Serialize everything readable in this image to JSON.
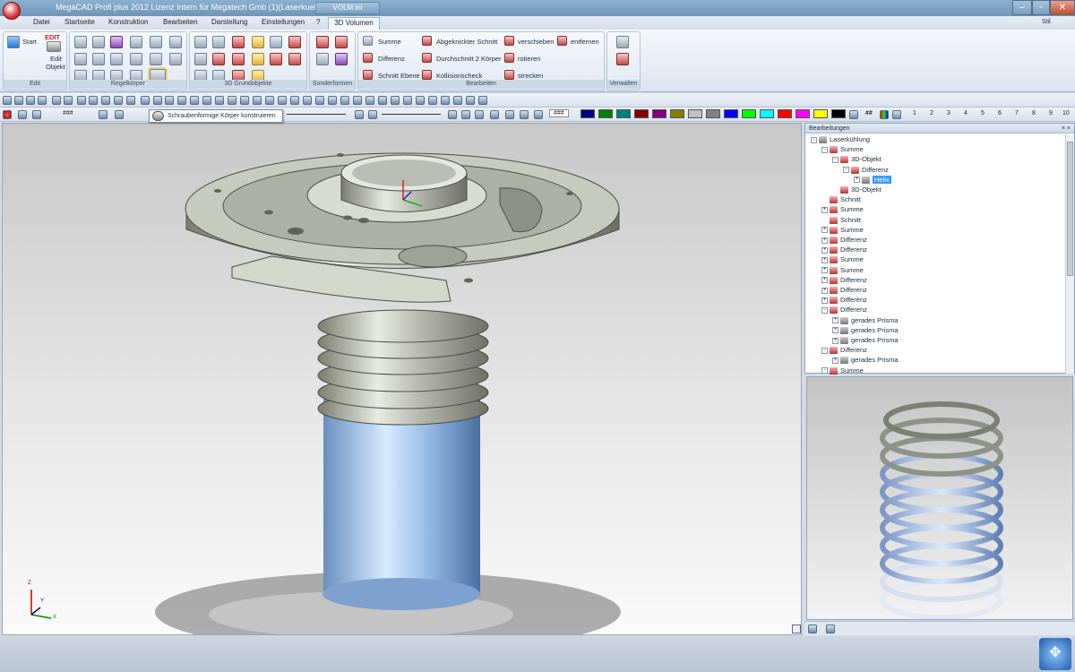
{
  "title": "MegaCAD Profi plus 2012  Lizenz Intern für Megatech Gmb (1)(Laserkuehlung.prt)",
  "file_tab": "VOLM.ini",
  "menus": [
    "Datei",
    "Startseite",
    "Konstruktion",
    "Bearbeiten",
    "Darstellung",
    "Einstellungen",
    "?",
    "3D Volumen"
  ],
  "menu_right": "Stil",
  "ribbon": {
    "edit": {
      "start": "Start",
      "edit_badge": "EDIT",
      "edit_label_1": "Edit",
      "edit_label_2": "Objekt",
      "label": "Edit"
    },
    "regel_label": "Regelkörper",
    "grund_label": "3D Grundobjekte",
    "sonder_label": "Sonderformen",
    "bearbeiten": {
      "label": "Bearbeiten",
      "col1": [
        "Summe",
        "Differenz",
        "Schnitt Ebene"
      ],
      "col2": [
        "Abgeknickter Schnitt",
        "Durchschnitt 2 Körper",
        "Kollisionscheck"
      ],
      "col3": [
        "verschieben",
        "rotieren",
        "strecken"
      ],
      "col4": [
        "entfernen"
      ]
    },
    "verwalten_label": "Verwalten"
  },
  "toolbar": {
    "hash1": "###",
    "hash2": "###",
    "hash3": "##",
    "numbers": [
      "1",
      "2",
      "3",
      "4",
      "5",
      "6",
      "7",
      "8",
      "9",
      "10"
    ],
    "colors": [
      "#000080",
      "#008000",
      "#008080",
      "#800000",
      "#800080",
      "#808000",
      "#c0c0c0",
      "#808080",
      "#0000ff",
      "#00ff00",
      "#00ffff",
      "#ff0000",
      "#ff00ff",
      "#ffff00",
      "#000000"
    ]
  },
  "tooltip": "Schraubenformige Körper konstruieren",
  "panel": {
    "title": "Bearbeitungen",
    "close": "× ×",
    "tree": [
      {
        "label": "Laserkühlung",
        "indent": 0,
        "expander": "-",
        "icon": "g"
      },
      {
        "label": "Summe",
        "indent": 1,
        "expander": "-",
        "icon": "r"
      },
      {
        "label": "3D-Objekt",
        "indent": 2,
        "expander": "-",
        "icon": "r"
      },
      {
        "label": "Differenz",
        "indent": 3,
        "expander": "-",
        "icon": "r"
      },
      {
        "label": "Helix",
        "indent": 4,
        "expander": "+",
        "icon": "g",
        "selected": true
      },
      {
        "label": "3D-Objekt",
        "indent": 2,
        "expander": "",
        "icon": "r"
      },
      {
        "label": "Schnitt",
        "indent": 1,
        "expander": "",
        "icon": "r"
      },
      {
        "label": "Summe",
        "indent": 1,
        "expander": "+",
        "icon": "r"
      },
      {
        "label": "Schnitt",
        "indent": 1,
        "expander": "",
        "icon": "r"
      },
      {
        "label": "Summe",
        "indent": 1,
        "expander": "+",
        "icon": "r"
      },
      {
        "label": "Differenz",
        "indent": 1,
        "expander": "+",
        "icon": "r"
      },
      {
        "label": "Differenz",
        "indent": 1,
        "expander": "+",
        "icon": "r"
      },
      {
        "label": "Summe",
        "indent": 1,
        "expander": "+",
        "icon": "r"
      },
      {
        "label": "Summe",
        "indent": 1,
        "expander": "+",
        "icon": "r"
      },
      {
        "label": "Differenz",
        "indent": 1,
        "expander": "+",
        "icon": "r"
      },
      {
        "label": "Differenz",
        "indent": 1,
        "expander": "+",
        "icon": "r"
      },
      {
        "label": "Differenz",
        "indent": 1,
        "expander": "+",
        "icon": "r"
      },
      {
        "label": "Differenz",
        "indent": 1,
        "expander": "-",
        "icon": "r"
      },
      {
        "label": "gerades Prisma",
        "indent": 2,
        "expander": "+",
        "icon": "g"
      },
      {
        "label": "gerades Prisma",
        "indent": 2,
        "expander": "+",
        "icon": "g"
      },
      {
        "label": "gerades Prisma",
        "indent": 2,
        "expander": "+",
        "icon": "g"
      },
      {
        "label": "Differenz",
        "indent": 1,
        "expander": "-",
        "icon": "r"
      },
      {
        "label": "gerades Prisma",
        "indent": 2,
        "expander": "+",
        "icon": "g"
      },
      {
        "label": "Summe",
        "indent": 1,
        "expander": "-",
        "icon": "r"
      }
    ]
  },
  "viewport": {
    "axis_z": "Z",
    "axis_y": "Y",
    "axis_x": "X"
  }
}
